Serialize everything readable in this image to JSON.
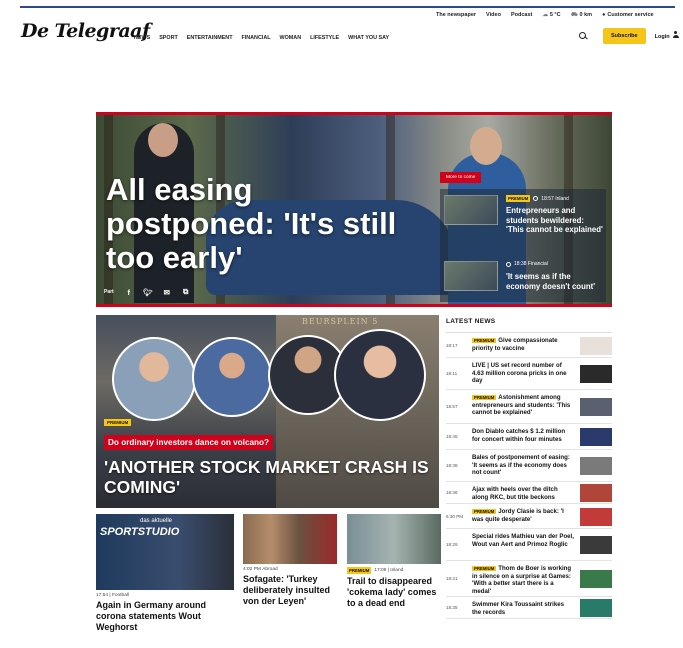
{
  "util_bar": {
    "items": [
      "The newspaper",
      "Video",
      "Podcast"
    ],
    "weather": "5 °C",
    "traffic": "0 km",
    "customer_service": "Customer service"
  },
  "header": {
    "logo": "De Telegraaf",
    "nav": [
      "NEWS",
      "SPORT",
      "ENTERTAINMENT",
      "FINANCIAL",
      "WOMAN",
      "LIFESTYLE",
      "WHAT YOU SAY"
    ],
    "subscribe": "Subscribe",
    "login": "Login"
  },
  "hero": {
    "title": "All easing postponed: 'It's still too early'",
    "share_label": "Part",
    "more_tag": "More to come",
    "stories": [
      {
        "premium": "PREMIUM",
        "time": "18:57",
        "section": "Inland",
        "title": "Entrepreneurs and students bewildered: 'This cannot be explained'"
      },
      {
        "time": "18:38",
        "section": "Financial",
        "title": "'It seems as if the economy doesn't count'"
      }
    ]
  },
  "feature": {
    "sign": "BEURSPLEIN 5",
    "premium": "PREMIUM",
    "kicker": "Do ordinary investors dance on volcano?",
    "title": "'ANOTHER STOCK MARKET CRASH IS COMING'"
  },
  "cards": [
    {
      "studio": "SPORTSTUDIO",
      "studio_sub": "das aktuelle",
      "time": "17:54",
      "section": "Football",
      "title": "Again in Germany around corona statements Wout Weghorst"
    },
    {
      "time": "4:02 PM",
      "section": "Abroad",
      "title": "Sofagate: 'Turkey deliberately insulted von der Leyen'"
    },
    {
      "premium": "PREMIUM",
      "time": "17:09",
      "section": "Inland",
      "title": "Trail to disappeared 'cokema lady' comes to a dead end"
    }
  ],
  "latest_news": {
    "heading": "LATEST NEWS",
    "items": [
      {
        "time": "18:17",
        "premium": "PREMIUM",
        "text": "Give compassionate priority to vaccine",
        "thumb_color": "#e8e0da"
      },
      {
        "time": "18:11",
        "text": "LIVE | US set record number of 4.63 million corona pricks in one day",
        "thumb_color": "#2a2a2a"
      },
      {
        "time": "18:57",
        "premium": "PREMIUM",
        "text": "Astonishment among entrepreneurs and students: 'This cannot be explained'",
        "thumb_color": "#5a6070"
      },
      {
        "time": "18:45",
        "text": "Don Diablo catches $ 1.2 million for concert within four minutes",
        "thumb_color": "#2a3a6a"
      },
      {
        "time": "18:38",
        "text": "Bales of postponement of easing: 'It seems as if the economy does not count'",
        "thumb_color": "#7a7a7a"
      },
      {
        "time": "18:36",
        "text": "Ajax with heels over the ditch along RKC, but title beckons",
        "thumb_color": "#b0463a"
      },
      {
        "time": "6:30 PM",
        "premium": "PREMIUM",
        "text": "Jordy Clasie is back: 'I was quite desperate'",
        "thumb_color": "#c23a3a"
      },
      {
        "time": "18:29",
        "text": "Special rides Mathieu van der Poel, Wout van Aert and Primoz Roglic",
        "thumb_color": "#3a3a3a"
      },
      {
        "time": "18:21",
        "premium": "PREMIUM",
        "text": "Thom de Boer is working in silence on a surprise at Games: 'With a better start there is a medal'",
        "thumb_color": "#3a7a4a"
      },
      {
        "time": "18:35",
        "text": "Swimmer Kira Toussaint strikes the records",
        "thumb_color": "#2a7a6a"
      }
    ]
  }
}
